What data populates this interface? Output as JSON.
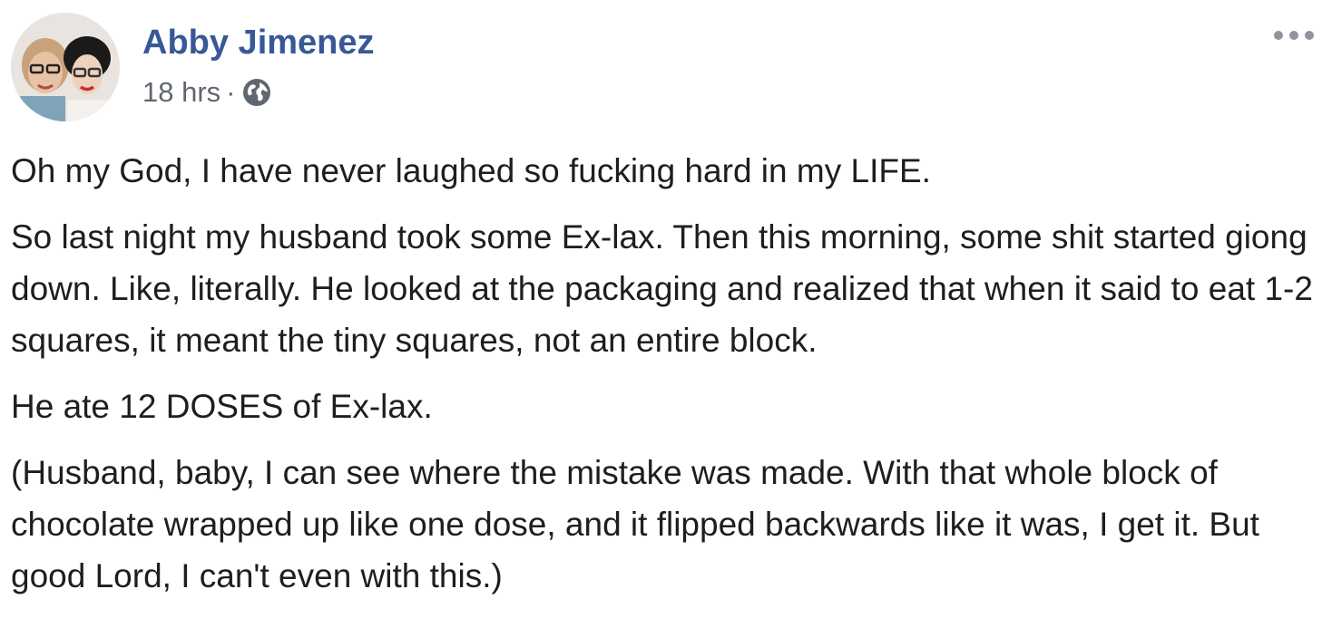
{
  "post": {
    "author": "Abby Jimenez",
    "timestamp": "18 hrs",
    "separator": "·",
    "privacy_icon": "globe-icon",
    "more_icon": "more-options-icon",
    "author_color": "#385898",
    "paragraphs": [
      "Oh my God, I have never laughed so fucking hard in my LIFE.",
      "So last night my husband took some Ex-lax. Then this morning, some shit started giong down. Like, literally. He looked at the packaging and realized that when it said to eat 1-2 squares, it meant the tiny squares, not an entire block.",
      "He ate 12 DOSES of Ex-lax.",
      "(Husband, baby, I can see where the mistake was made. With that whole block of chocolate wrapped up like one dose, and it flipped backwards like it was, I get it. But good Lord, I can't even with this.)"
    ]
  }
}
